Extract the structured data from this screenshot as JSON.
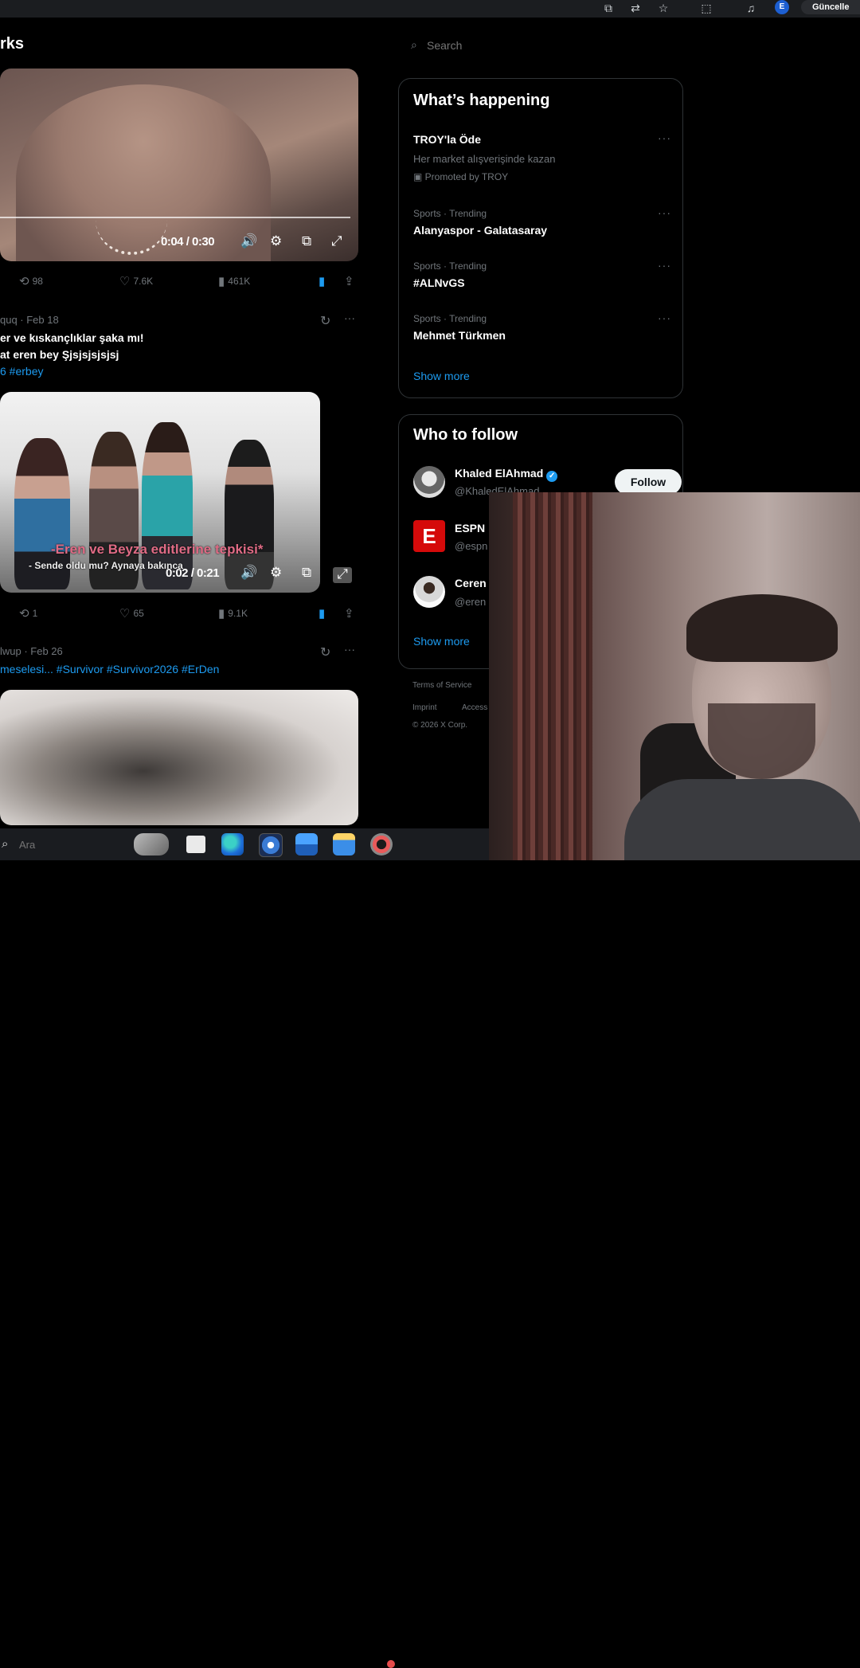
{
  "browser": {
    "update_label": "Güncelle",
    "profile_initial": "E"
  },
  "feed": {
    "title": "rks",
    "tweets": [
      {
        "video": {
          "time": "0:04 / 0:30"
        },
        "actions": {
          "retweets": "98",
          "likes": "7.6K",
          "views": "461K"
        }
      },
      {
        "head": "quq · Feb 18",
        "text_line1": "er ve kıskançlıklar şaka mı!",
        "text_line2": "at eren bey Şjsjsjsjsjsj",
        "hashtags": "6 #erbey",
        "video": {
          "time": "0:02 / 0:21",
          "subtitle_pink": "-Eren ve Beyza editlerine tepkisi*",
          "subtitle_white": "- Sende oldu mu? Aynaya bakınca"
        },
        "actions": {
          "retweets": "1",
          "likes": "65",
          "views": "9.1K"
        }
      },
      {
        "head": "lwup · Feb 26",
        "text_line1": "meselesi... #Survivor #Survivor2026 #ErDen"
      }
    ]
  },
  "sidebar": {
    "search_placeholder": "Search",
    "whats_happening": {
      "title": "What’s happening",
      "trends": [
        {
          "name": "TROY'la Öde",
          "sub": "Her market alışverişinde kazan",
          "promo": "Promoted by TROY"
        },
        {
          "meta": "Sports · Trending",
          "name": "Alanyaspor - Galatasaray"
        },
        {
          "meta": "Sports · Trending",
          "name": "#ALNvGS"
        },
        {
          "meta": "Sports · Trending",
          "name": "Mehmet Türkmen"
        }
      ],
      "show_more": "Show more"
    },
    "who_to_follow": {
      "title": "Who to follow",
      "accounts": [
        {
          "name": "Khaled ElAhmad",
          "handle": "@KhaledElAhmad",
          "verified": true
        },
        {
          "name": "ESPN",
          "handle": "@espn"
        },
        {
          "name": "Ceren",
          "handle": "@eren"
        }
      ],
      "follow_label": "Follow",
      "show_more": "Show more"
    },
    "footer": {
      "terms": "Terms of Service",
      "imprint": "Imprint",
      "access": "Access",
      "copyright": "© 2026 X Corp."
    }
  },
  "taskbar": {
    "search_placeholder": "Ara"
  },
  "colors": {
    "accent": "#1d9bf0",
    "muted": "#71767b",
    "border": "#2f3336",
    "espn_red": "#d50a0a"
  }
}
